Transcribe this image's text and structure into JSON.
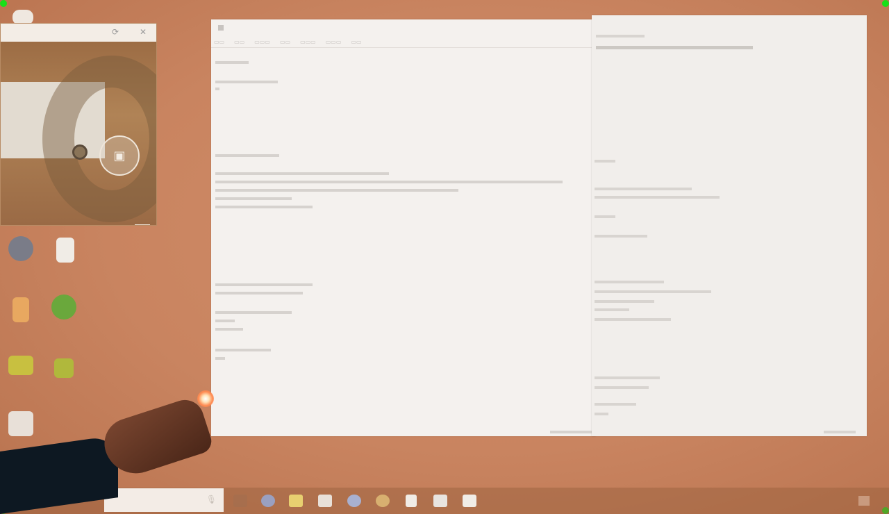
{
  "camera_window": {
    "titlebar_icons": [
      "restore-icon",
      "close-icon"
    ],
    "controls": [
      "switch-camera-icon",
      "shutter-icon",
      "gallery-icon"
    ]
  },
  "desktop_icons": [
    {
      "name": "app-icon-1",
      "color": "#7a7c88"
    },
    {
      "name": "app-icon-2",
      "color": "#f0ece6"
    },
    {
      "name": "app-icon-3",
      "color": "#e8a860"
    },
    {
      "name": "app-icon-4",
      "color": "#6aa83c"
    },
    {
      "name": "app-icon-5",
      "color": "#c8c040"
    },
    {
      "name": "app-icon-6",
      "color": "#b0b83c"
    },
    {
      "name": "app-icon-7",
      "color": "#e8e0d8"
    }
  ],
  "taskbar": {
    "pinned_apps": [
      "task-view-icon",
      "browser-icon",
      "file-explorer-icon",
      "store-icon",
      "settings-icon",
      "media-icon",
      "document-icon",
      "paint-icon",
      "camera-icon"
    ]
  },
  "colors": {
    "projection_wall": "#c8825e",
    "editor_bg": "#f4f1ee",
    "laser": "#ff8a50"
  }
}
